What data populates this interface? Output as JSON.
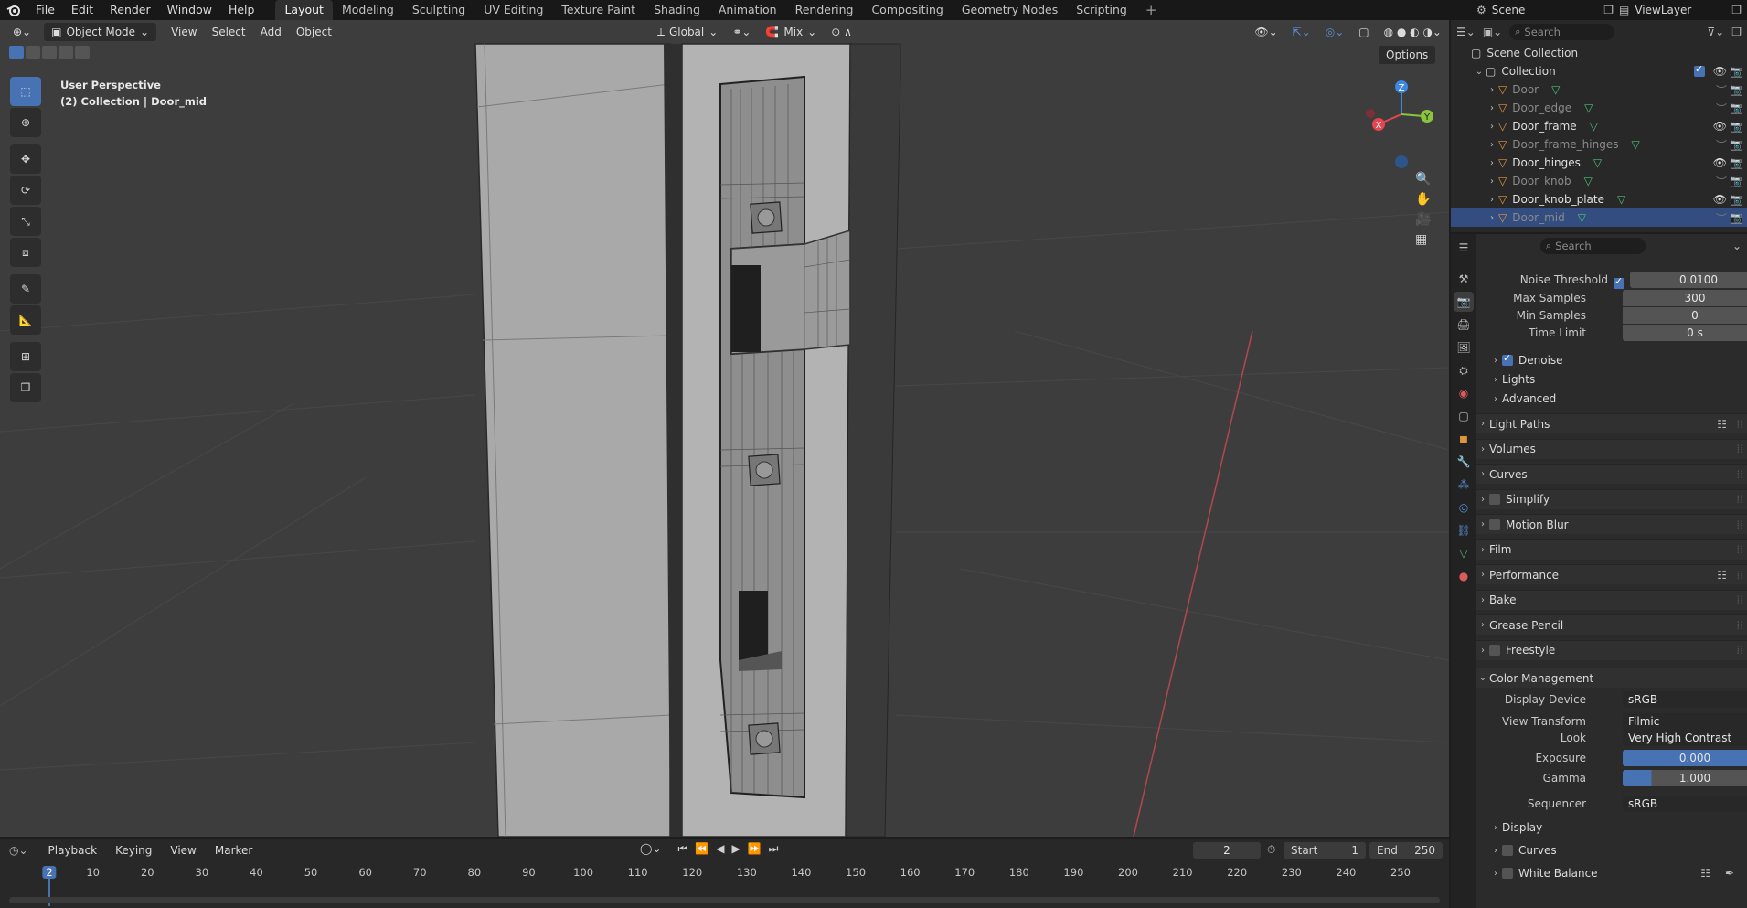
{
  "topbar": {
    "menus": [
      "File",
      "Edit",
      "Render",
      "Window",
      "Help"
    ],
    "workspaces": [
      "Layout",
      "Modeling",
      "Sculpting",
      "UV Editing",
      "Texture Paint",
      "Shading",
      "Animation",
      "Rendering",
      "Compositing",
      "Geometry Nodes",
      "Scripting"
    ],
    "active_workspace": "Layout",
    "scene_name": "Scene",
    "view_layer": "ViewLayer"
  },
  "viewport": {
    "mode": "Object Mode",
    "menus": [
      "View",
      "Select",
      "Add",
      "Object"
    ],
    "transform_orientation": "Global",
    "snap_mode": "Mix",
    "options_label": "Options",
    "info_line1": "User Perspective",
    "info_line2": "(2) Collection | Door_mid",
    "gizmo_axes": {
      "x": "X",
      "y": "Y",
      "z": "Z"
    }
  },
  "outliner": {
    "search_placeholder": "Search",
    "root": "Scene Collection",
    "collection": "Collection",
    "objects": [
      {
        "name": "Door",
        "visible": false
      },
      {
        "name": "Door_edge",
        "visible": false
      },
      {
        "name": "Door_frame",
        "visible": true
      },
      {
        "name": "Door_frame_hinges",
        "visible": false
      },
      {
        "name": "Door_hinges",
        "visible": true
      },
      {
        "name": "Door_knob",
        "visible": false
      },
      {
        "name": "Door_knob_plate",
        "visible": true
      },
      {
        "name": "Door_mid",
        "visible": false,
        "selected": true
      }
    ]
  },
  "properties": {
    "search_placeholder": "Search",
    "noise_threshold": {
      "label": "Noise Threshold",
      "value": "0.0100",
      "enabled": true
    },
    "max_samples": {
      "label": "Max Samples",
      "value": "300"
    },
    "min_samples": {
      "label": "Min Samples",
      "value": "0"
    },
    "time_limit": {
      "label": "Time Limit",
      "value": "0 s"
    },
    "subsections": [
      {
        "label": "Denoise",
        "checkbox": true,
        "checked": true
      },
      {
        "label": "Lights"
      },
      {
        "label": "Advanced"
      }
    ],
    "sections": [
      {
        "label": "Light Paths",
        "list": true
      },
      {
        "label": "Volumes"
      },
      {
        "label": "Curves"
      },
      {
        "label": "Simplify",
        "checkbox": true
      },
      {
        "label": "Motion Blur",
        "checkbox": true
      },
      {
        "label": "Film"
      },
      {
        "label": "Performance",
        "list": true
      },
      {
        "label": "Bake"
      },
      {
        "label": "Grease Pencil"
      },
      {
        "label": "Freestyle",
        "checkbox": true
      }
    ],
    "color_management": {
      "label": "Color Management",
      "display_device": {
        "label": "Display Device",
        "value": "sRGB"
      },
      "view_transform": {
        "label": "View Transform",
        "value": "Filmic"
      },
      "look": {
        "label": "Look",
        "value": "Very High Contrast"
      },
      "exposure": {
        "label": "Exposure",
        "value": "0.000"
      },
      "gamma": {
        "label": "Gamma",
        "value": "1.000"
      },
      "sequencer": {
        "label": "Sequencer",
        "value": "sRGB"
      },
      "sub": [
        {
          "label": "Display"
        },
        {
          "label": "Curves",
          "checkbox": true
        },
        {
          "label": "White Balance",
          "checkbox": true
        }
      ]
    }
  },
  "timeline": {
    "menus": [
      "Playback",
      "Keying",
      "View",
      "Marker"
    ],
    "current_frame": "2",
    "start_label": "Start",
    "start": "1",
    "end_label": "End",
    "end": "250",
    "ticks": [
      "2",
      "10",
      "20",
      "30",
      "40",
      "50",
      "60",
      "70",
      "80",
      "90",
      "100",
      "110",
      "120",
      "130",
      "140",
      "150",
      "160",
      "170",
      "180",
      "190",
      "200",
      "210",
      "220",
      "230",
      "240",
      "250"
    ]
  },
  "colors": {
    "accent": "#4772b3",
    "selection": "#334d80",
    "x_axis": "#e54550",
    "y_axis": "#8bc53d",
    "z_axis": "#3d87e5"
  }
}
